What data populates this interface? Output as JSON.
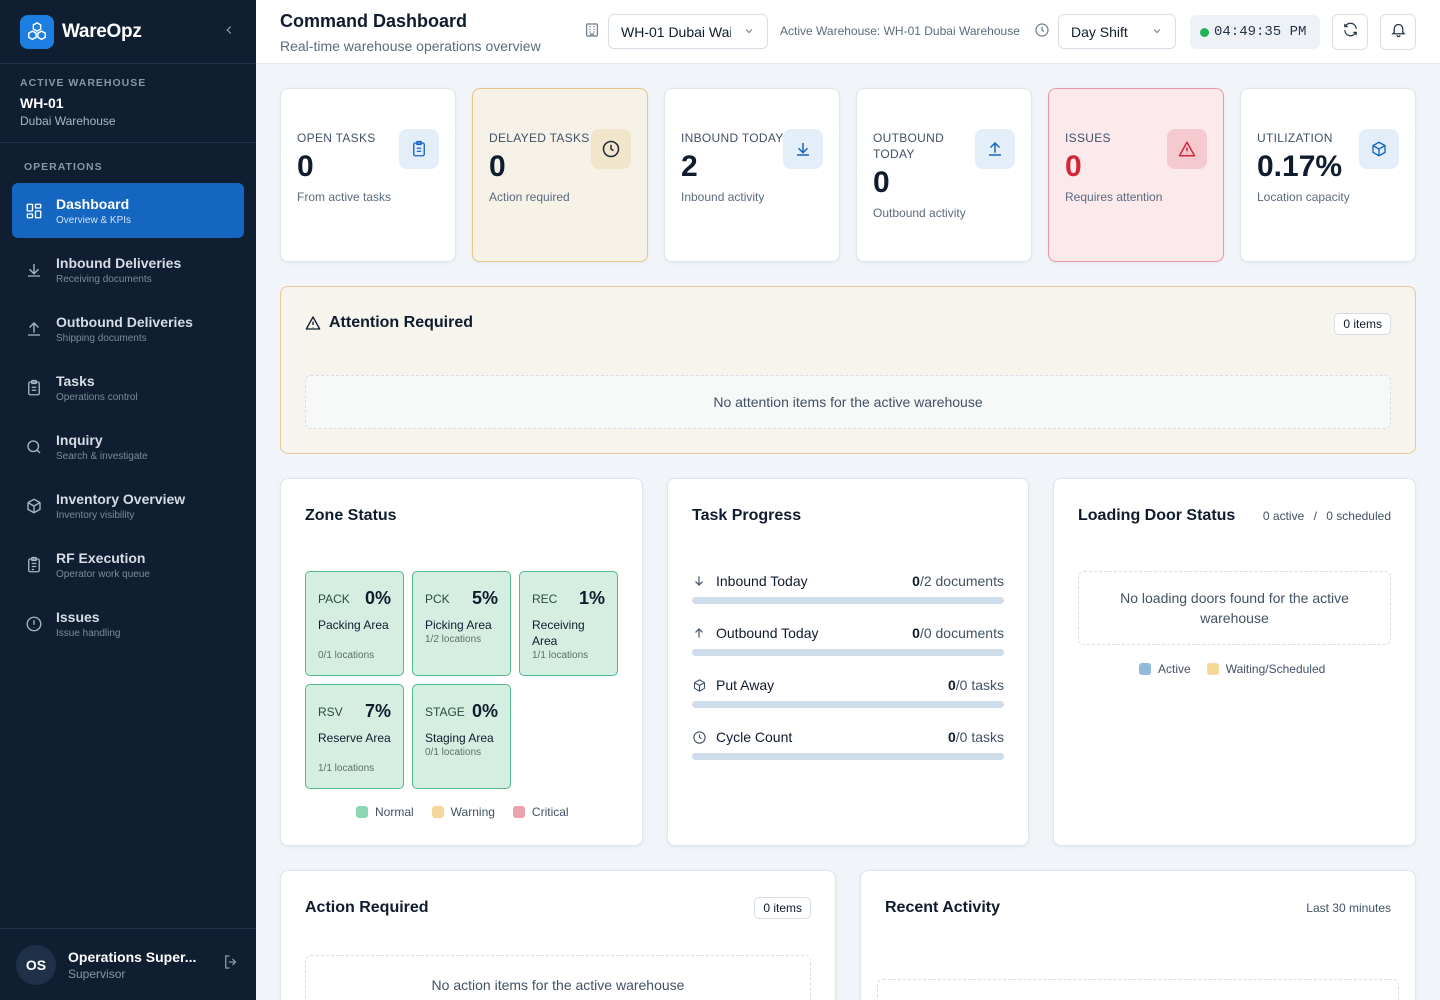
{
  "brand": {
    "name": "WareOpz"
  },
  "sidebar": {
    "warehouse_caption": "ACTIVE WAREHOUSE",
    "warehouse_code": "WH-01",
    "warehouse_name": "Dubai Warehouse",
    "section_caption": "OPERATIONS",
    "items": [
      {
        "label": "Dashboard",
        "sub": "Overview & KPIs"
      },
      {
        "label": "Inbound Deliveries",
        "sub": "Receiving documents"
      },
      {
        "label": "Outbound Deliveries",
        "sub": "Shipping documents"
      },
      {
        "label": "Tasks",
        "sub": "Operations control"
      },
      {
        "label": "Inquiry",
        "sub": "Search & investigate"
      },
      {
        "label": "Inventory Overview",
        "sub": "Inventory visibility"
      },
      {
        "label": "RF Execution",
        "sub": "Operator work queue"
      },
      {
        "label": "Issues",
        "sub": "Issue handling"
      }
    ],
    "user": {
      "initials": "OS",
      "name": "Operations Super...",
      "role": "Supervisor"
    }
  },
  "header": {
    "title": "Command Dashboard",
    "subtitle": "Real-time warehouse operations overview",
    "warehouse_select": "WH-01 Dubai Wai",
    "active_warehouse": "Active Warehouse: WH-01 Dubai Warehouse",
    "shift_select": "Day Shift",
    "clock": "04:49:35 PM"
  },
  "kpis": [
    {
      "label": "OPEN TASKS",
      "value": "0",
      "note": "From active tasks"
    },
    {
      "label": "DELAYED TASKS",
      "value": "0",
      "note": "Action required"
    },
    {
      "label": "INBOUND TODAY",
      "value": "2",
      "note": "Inbound activity"
    },
    {
      "label": "OUTBOUND TODAY",
      "value": "0",
      "note": "Outbound activity"
    },
    {
      "label": "ISSUES",
      "value": "0",
      "note": "Requires attention"
    },
    {
      "label": "UTILIZATION",
      "value": "0.17%",
      "note": "Location capacity"
    }
  ],
  "attention": {
    "title": "Attention Required",
    "badge": "0 items",
    "empty": "No attention items for the active warehouse"
  },
  "zone_status": {
    "title": "Zone Status",
    "zones": [
      {
        "code": "PACK",
        "pct": "0%",
        "name": "Packing Area",
        "locations": "0/1 locations"
      },
      {
        "code": "PCK",
        "pct": "5%",
        "name": "Picking Area",
        "locations": "1/2 locations"
      },
      {
        "code": "REC",
        "pct": "1%",
        "name": "Receiving Area",
        "locations": "1/1 locations"
      },
      {
        "code": "RSV",
        "pct": "7%",
        "name": "Reserve Area",
        "locations": "1/1 locations"
      },
      {
        "code": "STAGE",
        "pct": "0%",
        "name": "Staging Area",
        "locations": "0/1 locations"
      }
    ],
    "legend": [
      "Normal",
      "Warning",
      "Critical"
    ],
    "colors": {
      "normal": "#8fd6b2",
      "warning": "#f3d89a",
      "critical": "#eaa3ad"
    }
  },
  "task_progress": {
    "title": "Task Progress",
    "rows": [
      {
        "label": "Inbound Today",
        "done": "0",
        "rest": "/2 documents",
        "progress": 0
      },
      {
        "label": "Outbound Today",
        "done": "0",
        "rest": "/0 documents",
        "progress": 0
      },
      {
        "label": "Put Away",
        "done": "0",
        "rest": "/0 tasks",
        "progress": 0
      },
      {
        "label": "Cycle Count",
        "done": "0",
        "rest": "/0 tasks",
        "progress": 0
      }
    ]
  },
  "loading_doors": {
    "title": "Loading Door Status",
    "active": "0 active",
    "separator": "/",
    "scheduled": "0 scheduled",
    "empty": "No loading doors found for the active warehouse",
    "legend": [
      "Active",
      "Waiting/Scheduled"
    ],
    "colors": {
      "active": "#93b9dc",
      "waiting": "#f3d89a"
    }
  },
  "action_required": {
    "title": "Action Required",
    "badge": "0 items",
    "empty": "No action items for the active warehouse"
  },
  "recent_activity": {
    "title": "Recent Activity",
    "window": "Last 30 minutes"
  }
}
